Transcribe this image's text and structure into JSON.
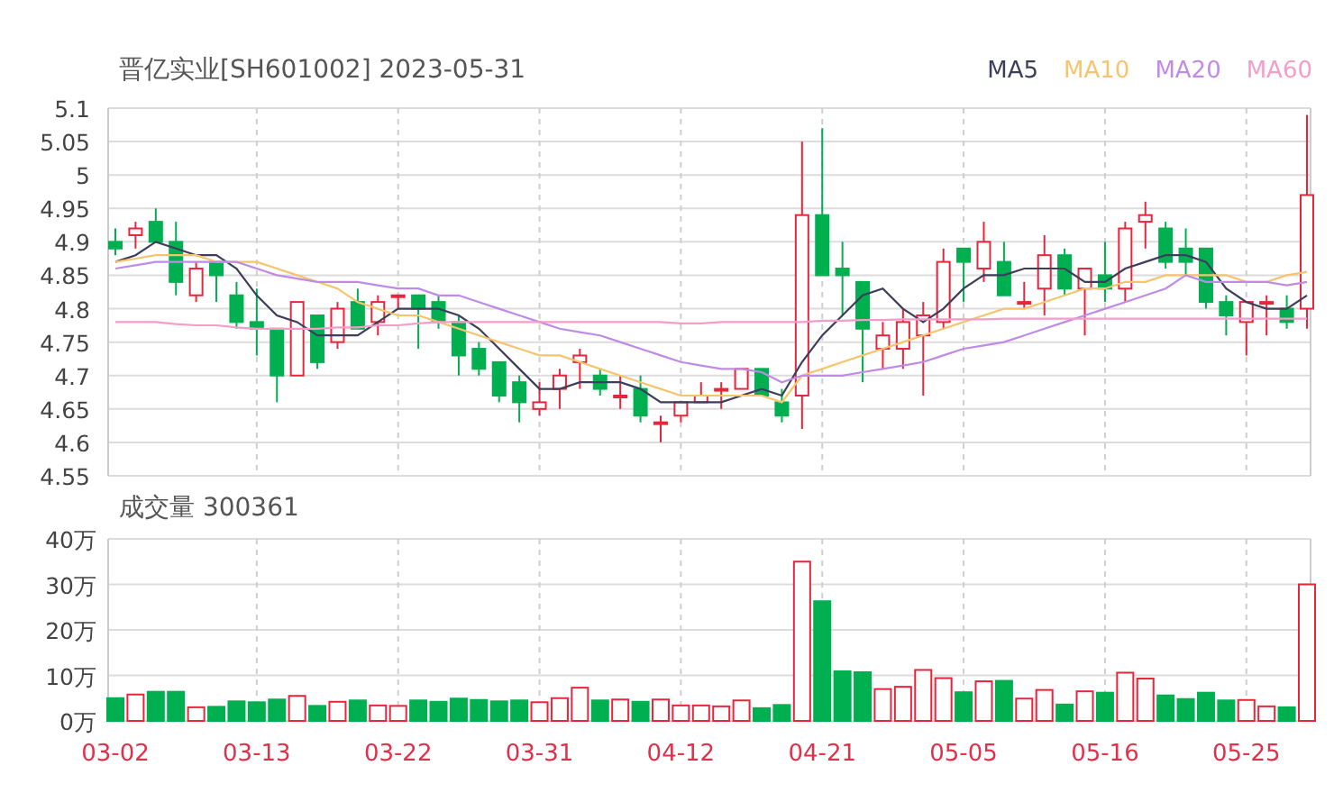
{
  "price_chart": {
    "chart_data": {
      "type": "candlestick",
      "title": "晋亿实业[SH601002] 2023-05-31",
      "grid": true,
      "ylim": [
        4.55,
        5.1
      ],
      "categories": [
        null,
        null,
        null,
        null,
        null,
        null,
        null,
        null,
        null,
        null,
        null,
        null,
        null,
        null,
        null,
        null,
        null,
        null,
        null,
        null,
        null,
        null,
        null,
        null,
        null,
        null,
        null,
        null,
        null,
        null,
        null,
        null,
        null,
        null,
        null,
        null,
        null,
        null,
        null,
        null,
        null,
        null,
        null,
        null,
        null,
        null,
        null,
        null,
        null,
        null,
        null,
        null,
        null,
        null,
        null,
        null,
        null,
        null,
        null,
        null
      ],
      "yticks": [
        {
          "value": 5.1,
          "label": "5.1"
        },
        {
          "value": 5.05,
          "label": "5.05"
        },
        {
          "value": 5,
          "label": "5"
        },
        {
          "value": 4.95,
          "label": "4.95"
        },
        {
          "value": 4.9,
          "label": "4.9"
        },
        {
          "value": 4.85,
          "label": "4.85"
        },
        {
          "value": 4.8,
          "label": "4.8"
        },
        {
          "value": 4.75,
          "label": "4.75"
        },
        {
          "value": 4.7,
          "label": "4.7"
        },
        {
          "value": 4.65,
          "label": "4.65"
        },
        {
          "value": 4.6,
          "label": "4.6"
        },
        {
          "value": 4.55,
          "label": "4.55"
        }
      ],
      "ohlc": [
        [
          4.9,
          4.92,
          4.88,
          4.89
        ],
        [
          4.91,
          4.93,
          4.89,
          4.92
        ],
        [
          4.93,
          4.95,
          4.9,
          4.9
        ],
        [
          4.9,
          4.93,
          4.82,
          4.84
        ],
        [
          4.82,
          4.87,
          4.81,
          4.86
        ],
        [
          4.87,
          4.87,
          4.81,
          4.85
        ],
        [
          4.82,
          4.84,
          4.77,
          4.78
        ],
        [
          4.78,
          4.83,
          4.73,
          4.77
        ],
        [
          4.77,
          4.77,
          4.66,
          4.7
        ],
        [
          4.7,
          4.81,
          4.7,
          4.81
        ],
        [
          4.79,
          4.79,
          4.71,
          4.72
        ],
        [
          4.75,
          4.81,
          4.74,
          4.8
        ],
        [
          4.81,
          4.83,
          4.77,
          4.77
        ],
        [
          4.78,
          4.82,
          4.76,
          4.81
        ],
        [
          4.82,
          4.82,
          4.8,
          4.82
        ],
        [
          4.82,
          4.82,
          4.74,
          4.8
        ],
        [
          4.81,
          4.82,
          4.77,
          4.78
        ],
        [
          4.78,
          4.79,
          4.7,
          4.73
        ],
        [
          4.74,
          4.75,
          4.7,
          4.71
        ],
        [
          4.72,
          4.72,
          4.66,
          4.67
        ],
        [
          4.69,
          4.7,
          4.63,
          4.66
        ],
        [
          4.65,
          4.69,
          4.64,
          4.66
        ],
        [
          4.68,
          4.71,
          4.65,
          4.7
        ],
        [
          4.72,
          4.74,
          4.68,
          4.73
        ],
        [
          4.7,
          4.71,
          4.67,
          4.68
        ],
        [
          4.67,
          4.7,
          4.65,
          4.67
        ],
        [
          4.68,
          4.7,
          4.63,
          4.64
        ],
        [
          4.63,
          4.64,
          4.6,
          4.63
        ],
        [
          4.64,
          4.66,
          4.63,
          4.66
        ],
        [
          4.66,
          4.69,
          4.66,
          4.67
        ],
        [
          4.68,
          4.69,
          4.65,
          4.68
        ],
        [
          4.68,
          4.71,
          4.68,
          4.71
        ],
        [
          4.71,
          4.71,
          4.67,
          4.67
        ],
        [
          4.66,
          4.68,
          4.63,
          4.64
        ],
        [
          4.67,
          5.05,
          4.62,
          4.94
        ],
        [
          4.94,
          5.07,
          4.85,
          4.85
        ],
        [
          4.86,
          4.9,
          4.79,
          4.85
        ],
        [
          4.84,
          4.84,
          4.69,
          4.77
        ],
        [
          4.74,
          4.78,
          4.71,
          4.76
        ],
        [
          4.74,
          4.8,
          4.71,
          4.78
        ],
        [
          4.76,
          4.81,
          4.67,
          4.79
        ],
        [
          4.78,
          4.89,
          4.77,
          4.87
        ],
        [
          4.89,
          4.89,
          4.81,
          4.87
        ],
        [
          4.86,
          4.93,
          4.84,
          4.9
        ],
        [
          4.87,
          4.9,
          4.82,
          4.82
        ],
        [
          4.81,
          4.84,
          4.8,
          4.81
        ],
        [
          4.83,
          4.91,
          4.79,
          4.88
        ],
        [
          4.88,
          4.89,
          4.82,
          4.83
        ],
        [
          4.83,
          4.86,
          4.76,
          4.86
        ],
        [
          4.85,
          4.9,
          4.81,
          4.83
        ],
        [
          4.83,
          4.93,
          4.81,
          4.92
        ],
        [
          4.93,
          4.96,
          4.89,
          4.94
        ],
        [
          4.92,
          4.93,
          4.86,
          4.87
        ],
        [
          4.89,
          4.92,
          4.85,
          4.87
        ],
        [
          4.89,
          4.89,
          4.8,
          4.81
        ],
        [
          4.81,
          4.82,
          4.76,
          4.79
        ],
        [
          4.78,
          4.81,
          4.73,
          4.81
        ],
        [
          4.81,
          4.82,
          4.76,
          4.81
        ],
        [
          4.8,
          4.82,
          4.77,
          4.78
        ],
        [
          4.8,
          5.09,
          4.77,
          4.97
        ]
      ]
    },
    "ma_lines": {
      "chart_data": {
        "type": "line",
        "ylim": [
          4.55,
          5.1
        ],
        "categories": [
          null,
          null,
          null,
          null,
          null,
          null,
          null,
          null,
          null,
          null,
          null,
          null,
          null,
          null,
          null,
          null,
          null,
          null,
          null,
          null,
          null,
          null,
          null,
          null,
          null,
          null,
          null,
          null,
          null,
          null,
          null,
          null,
          null,
          null,
          null,
          null,
          null,
          null,
          null,
          null,
          null,
          null,
          null,
          null,
          null,
          null,
          null,
          null,
          null,
          null,
          null,
          null,
          null,
          null,
          null,
          null,
          null,
          null,
          null,
          null
        ],
        "series": [
          {
            "name": "MA5",
            "color": "#3d3d5c",
            "values": [
              4.87,
              4.88,
              4.9,
              4.89,
              4.88,
              4.88,
              4.86,
              4.82,
              4.79,
              4.78,
              4.76,
              4.76,
              4.76,
              4.78,
              4.8,
              4.8,
              4.8,
              4.79,
              4.77,
              4.74,
              4.71,
              4.68,
              4.68,
              4.69,
              4.69,
              4.69,
              4.68,
              4.66,
              4.66,
              4.66,
              4.66,
              4.67,
              4.68,
              4.67,
              4.72,
              4.76,
              4.79,
              4.82,
              4.83,
              4.8,
              4.78,
              4.8,
              4.83,
              4.85,
              4.85,
              4.86,
              4.86,
              4.86,
              4.84,
              4.84,
              4.86,
              4.87,
              4.88,
              4.88,
              4.87,
              4.83,
              4.81,
              4.8,
              4.8,
              4.82
            ]
          },
          {
            "name": "MA10",
            "color": "#f7c46e",
            "values": [
              4.87,
              4.875,
              4.88,
              4.88,
              4.88,
              4.87,
              4.87,
              4.87,
              4.86,
              4.85,
              4.84,
              4.83,
              4.81,
              4.8,
              4.79,
              4.79,
              4.78,
              4.77,
              4.76,
              4.75,
              4.74,
              4.73,
              4.73,
              4.72,
              4.71,
              4.7,
              4.69,
              4.68,
              4.67,
              4.67,
              4.67,
              4.67,
              4.67,
              4.66,
              4.7,
              4.71,
              4.72,
              4.73,
              4.74,
              4.75,
              4.76,
              4.77,
              4.78,
              4.79,
              4.8,
              4.8,
              4.81,
              4.82,
              4.83,
              4.83,
              4.84,
              4.84,
              4.85,
              4.85,
              4.85,
              4.85,
              4.84,
              4.84,
              4.85,
              4.855
            ]
          },
          {
            "name": "MA20",
            "color": "#c08be8",
            "values": [
              4.86,
              4.865,
              4.87,
              4.87,
              4.87,
              4.87,
              4.87,
              4.86,
              4.85,
              4.845,
              4.84,
              4.84,
              4.84,
              4.835,
              4.83,
              4.83,
              4.82,
              4.82,
              4.81,
              4.8,
              4.79,
              4.78,
              4.77,
              4.765,
              4.76,
              4.75,
              4.74,
              4.73,
              4.72,
              4.715,
              4.71,
              4.71,
              4.705,
              4.69,
              4.7,
              4.7,
              4.7,
              4.705,
              4.71,
              4.715,
              4.72,
              4.73,
              4.74,
              4.745,
              4.75,
              4.76,
              4.77,
              4.78,
              4.79,
              4.8,
              4.81,
              4.82,
              4.83,
              4.85,
              4.84,
              4.84,
              4.84,
              4.84,
              4.835,
              4.84
            ]
          },
          {
            "name": "MA60",
            "color": "#f59cc8",
            "values": [
              4.78,
              4.78,
              4.78,
              4.777,
              4.775,
              4.775,
              4.772,
              4.77,
              4.77,
              4.77,
              4.77,
              4.772,
              4.772,
              4.775,
              4.775,
              4.778,
              4.78,
              4.78,
              4.78,
              4.78,
              4.78,
              4.78,
              4.78,
              4.78,
              4.78,
              4.78,
              4.78,
              4.78,
              4.778,
              4.778,
              4.78,
              4.78,
              4.78,
              4.78,
              4.78,
              4.782,
              4.782,
              4.783,
              4.783,
              4.784,
              4.784,
              4.784,
              4.784,
              4.784,
              4.785,
              4.785,
              4.785,
              4.785,
              4.785,
              4.785,
              4.785,
              4.785,
              4.785,
              4.785,
              4.785,
              4.785,
              4.785,
              4.785,
              4.785,
              4.785
            ]
          }
        ]
      }
    }
  },
  "volume_chart": {
    "chart_data": {
      "type": "bar",
      "title": "成交量 300361",
      "grid": true,
      "ylim": [
        0,
        40
      ],
      "categories": [
        "03-02",
        null,
        null,
        null,
        null,
        null,
        null,
        "03-13",
        null,
        null,
        null,
        null,
        null,
        null,
        "03-22",
        null,
        null,
        null,
        null,
        null,
        null,
        "03-31",
        null,
        null,
        null,
        null,
        null,
        null,
        "04-12",
        null,
        null,
        null,
        null,
        null,
        null,
        "04-21",
        null,
        null,
        null,
        null,
        null,
        null,
        "05-05",
        null,
        null,
        null,
        null,
        null,
        null,
        "05-16",
        null,
        null,
        null,
        null,
        null,
        null,
        "05-25",
        null,
        null,
        null
      ],
      "yticks": [
        {
          "value": 0,
          "label": "0万"
        },
        {
          "value": 10,
          "label": "10万"
        },
        {
          "value": 20,
          "label": "20万"
        },
        {
          "value": 30,
          "label": "30万"
        },
        {
          "value": 40,
          "label": "40万"
        }
      ],
      "values": [
        5.0,
        5.8,
        6.4,
        6.4,
        3.0,
        3.1,
        4.3,
        4.1,
        4.7,
        5.5,
        3.3,
        4.2,
        4.5,
        3.4,
        3.3,
        4.5,
        4.2,
        4.9,
        4.6,
        4.3,
        4.5,
        4.1,
        5.0,
        7.3,
        4.5,
        4.7,
        4.2,
        4.7,
        3.4,
        3.4,
        3.2,
        4.5,
        2.8,
        3.5,
        35.0,
        26.3,
        10.9,
        10.7,
        7.0,
        7.5,
        11.2,
        9.4,
        6.3,
        8.7,
        8.8,
        4.9,
        6.8,
        3.6,
        6.5,
        6.2,
        10.6,
        9.3,
        5.6,
        4.8,
        6.2,
        4.5,
        4.6,
        3.2,
        3.0,
        30.0
      ]
    }
  }
}
